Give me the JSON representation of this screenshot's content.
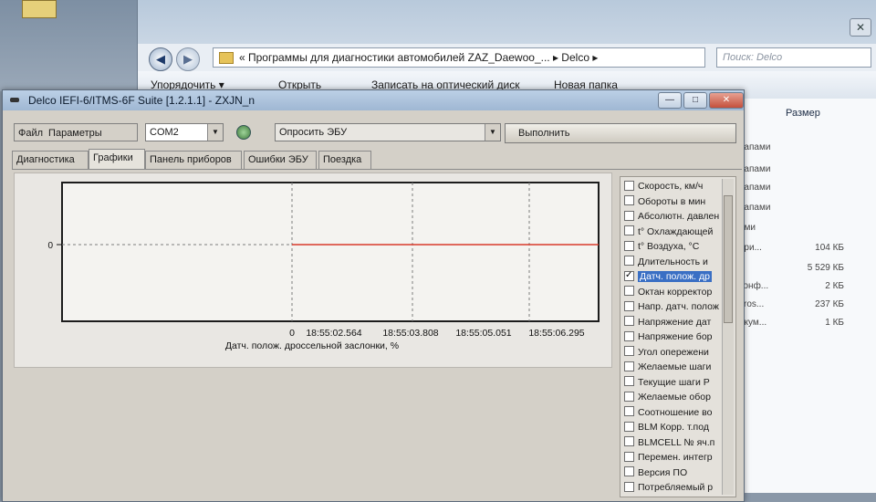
{
  "explorer": {
    "address_path": "«  Программы для диагностики автомобилей ZAZ_Daewoo_...  ▸  Delco  ▸",
    "search_placeholder": "Поиск: Delco",
    "toolbar": {
      "organize": "Упорядочить ▾",
      "open": "Открыть",
      "burn": "Записать на оптический диск",
      "new_folder": "Новая папка"
    },
    "column_size": "Размер",
    "name_fragments": [
      "папами",
      "папами",
      "папами",
      "папами",
      "ами",
      "при...",
      "",
      "конф...",
      "cros...",
      "окум..."
    ],
    "sizes": [
      "104 КБ",
      "5 529 КБ",
      "2 КБ",
      "237 КБ",
      "1 КБ"
    ]
  },
  "window": {
    "title": "Delco IEFI-6/ITMS-6F Suite [1.2.1.1] - ZXJN_n",
    "min": "—",
    "max": "□",
    "close": "✕"
  },
  "menu": {
    "file": "Файл",
    "params": "Параметры"
  },
  "port": {
    "value": "COM2"
  },
  "ecu_query": {
    "value": "Опросить ЭБУ"
  },
  "execute_label": "Выполнить",
  "tabs": [
    {
      "label": "Диагностика"
    },
    {
      "label": "Графики"
    },
    {
      "label": "Панель приборов"
    },
    {
      "label": "Ошибки ЭБУ"
    },
    {
      "label": "Поездка"
    }
  ],
  "active_tab": "Графики",
  "chart_data": {
    "type": "line",
    "title": "",
    "xlabel": "Датч. полож. дроссельной заслонки, %",
    "ylabel": "",
    "y_tick": "0",
    "x_ticks": [
      "0",
      "18:55:02.564",
      "18:55:03.808",
      "18:55:05.051",
      "18:55:06.295"
    ],
    "series": [
      {
        "name": "",
        "color": "#d83a2a",
        "x": [
          "0",
          "18:55:02.564",
          "18:55:03.808",
          "18:55:05.051",
          "18:55:06.295"
        ],
        "values": [
          0,
          0,
          0,
          0,
          0
        ]
      }
    ],
    "grid": true
  },
  "params": [
    {
      "label": "Скорость, км/ч",
      "checked": false,
      "selected": false
    },
    {
      "label": "Обороты в мин",
      "checked": false,
      "selected": false
    },
    {
      "label": "Абсолютн. давлен",
      "checked": false,
      "selected": false
    },
    {
      "label": "t° Охлаждающей",
      "checked": false,
      "selected": false
    },
    {
      "label": "t° Воздуха, °С",
      "checked": false,
      "selected": false
    },
    {
      "label": "Длительность и",
      "checked": false,
      "selected": false
    },
    {
      "label": "Датч. полож. др",
      "checked": true,
      "selected": true
    },
    {
      "label": "Октан корректор",
      "checked": false,
      "selected": false
    },
    {
      "label": "Напр. датч. полож",
      "checked": false,
      "selected": false
    },
    {
      "label": "Напряжение дат",
      "checked": false,
      "selected": false
    },
    {
      "label": "Напряжение бор",
      "checked": false,
      "selected": false
    },
    {
      "label": "Угол опережени",
      "checked": false,
      "selected": false
    },
    {
      "label": "Желаемые шаги",
      "checked": false,
      "selected": false
    },
    {
      "label": "Текущие шаги Р",
      "checked": false,
      "selected": false
    },
    {
      "label": "Желаемые обор",
      "checked": false,
      "selected": false
    },
    {
      "label": "Соотношение во",
      "checked": false,
      "selected": false
    },
    {
      "label": "BLM Корр. т.под",
      "checked": false,
      "selected": false
    },
    {
      "label": "BLMCELL № яч.п",
      "checked": false,
      "selected": false
    },
    {
      "label": "Перемен. интегр",
      "checked": false,
      "selected": false
    },
    {
      "label": "Версия ПО",
      "checked": false,
      "selected": false
    },
    {
      "label": "Потребляемый р",
      "checked": false,
      "selected": false
    }
  ]
}
